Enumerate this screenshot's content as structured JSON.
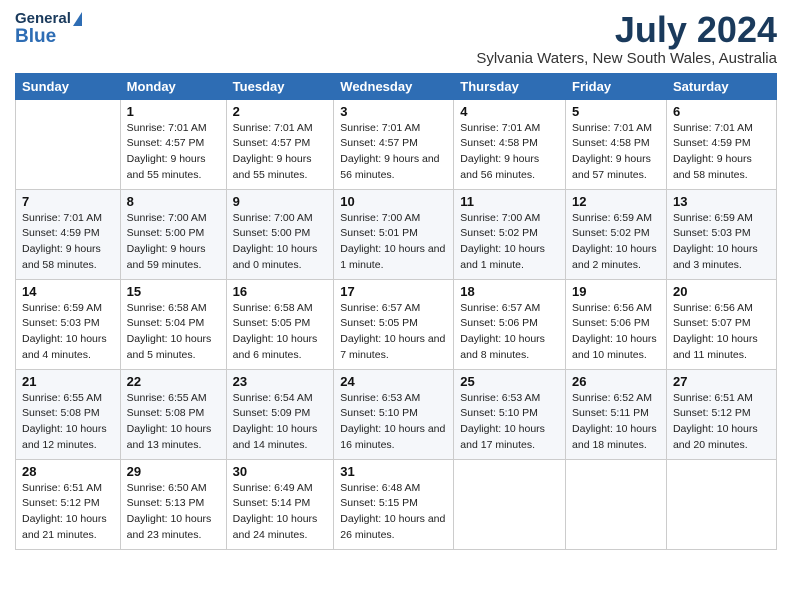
{
  "title": "July 2024",
  "subtitle": "Sylvania Waters, New South Wales, Australia",
  "logo": {
    "general": "General",
    "blue": "Blue"
  },
  "headers": [
    "Sunday",
    "Monday",
    "Tuesday",
    "Wednesday",
    "Thursday",
    "Friday",
    "Saturday"
  ],
  "weeks": [
    [
      {
        "day": "",
        "sunrise": "",
        "sunset": "",
        "daylight": ""
      },
      {
        "day": "1",
        "sunrise": "Sunrise: 7:01 AM",
        "sunset": "Sunset: 4:57 PM",
        "daylight": "Daylight: 9 hours and 55 minutes."
      },
      {
        "day": "2",
        "sunrise": "Sunrise: 7:01 AM",
        "sunset": "Sunset: 4:57 PM",
        "daylight": "Daylight: 9 hours and 55 minutes."
      },
      {
        "day": "3",
        "sunrise": "Sunrise: 7:01 AM",
        "sunset": "Sunset: 4:57 PM",
        "daylight": "Daylight: 9 hours and 56 minutes."
      },
      {
        "day": "4",
        "sunrise": "Sunrise: 7:01 AM",
        "sunset": "Sunset: 4:58 PM",
        "daylight": "Daylight: 9 hours and 56 minutes."
      },
      {
        "day": "5",
        "sunrise": "Sunrise: 7:01 AM",
        "sunset": "Sunset: 4:58 PM",
        "daylight": "Daylight: 9 hours and 57 minutes."
      },
      {
        "day": "6",
        "sunrise": "Sunrise: 7:01 AM",
        "sunset": "Sunset: 4:59 PM",
        "daylight": "Daylight: 9 hours and 58 minutes."
      }
    ],
    [
      {
        "day": "7",
        "sunrise": "Sunrise: 7:01 AM",
        "sunset": "Sunset: 4:59 PM",
        "daylight": "Daylight: 9 hours and 58 minutes."
      },
      {
        "day": "8",
        "sunrise": "Sunrise: 7:00 AM",
        "sunset": "Sunset: 5:00 PM",
        "daylight": "Daylight: 9 hours and 59 minutes."
      },
      {
        "day": "9",
        "sunrise": "Sunrise: 7:00 AM",
        "sunset": "Sunset: 5:00 PM",
        "daylight": "Daylight: 10 hours and 0 minutes."
      },
      {
        "day": "10",
        "sunrise": "Sunrise: 7:00 AM",
        "sunset": "Sunset: 5:01 PM",
        "daylight": "Daylight: 10 hours and 1 minute."
      },
      {
        "day": "11",
        "sunrise": "Sunrise: 7:00 AM",
        "sunset": "Sunset: 5:02 PM",
        "daylight": "Daylight: 10 hours and 1 minute."
      },
      {
        "day": "12",
        "sunrise": "Sunrise: 6:59 AM",
        "sunset": "Sunset: 5:02 PM",
        "daylight": "Daylight: 10 hours and 2 minutes."
      },
      {
        "day": "13",
        "sunrise": "Sunrise: 6:59 AM",
        "sunset": "Sunset: 5:03 PM",
        "daylight": "Daylight: 10 hours and 3 minutes."
      }
    ],
    [
      {
        "day": "14",
        "sunrise": "Sunrise: 6:59 AM",
        "sunset": "Sunset: 5:03 PM",
        "daylight": "Daylight: 10 hours and 4 minutes."
      },
      {
        "day": "15",
        "sunrise": "Sunrise: 6:58 AM",
        "sunset": "Sunset: 5:04 PM",
        "daylight": "Daylight: 10 hours and 5 minutes."
      },
      {
        "day": "16",
        "sunrise": "Sunrise: 6:58 AM",
        "sunset": "Sunset: 5:05 PM",
        "daylight": "Daylight: 10 hours and 6 minutes."
      },
      {
        "day": "17",
        "sunrise": "Sunrise: 6:57 AM",
        "sunset": "Sunset: 5:05 PM",
        "daylight": "Daylight: 10 hours and 7 minutes."
      },
      {
        "day": "18",
        "sunrise": "Sunrise: 6:57 AM",
        "sunset": "Sunset: 5:06 PM",
        "daylight": "Daylight: 10 hours and 8 minutes."
      },
      {
        "day": "19",
        "sunrise": "Sunrise: 6:56 AM",
        "sunset": "Sunset: 5:06 PM",
        "daylight": "Daylight: 10 hours and 10 minutes."
      },
      {
        "day": "20",
        "sunrise": "Sunrise: 6:56 AM",
        "sunset": "Sunset: 5:07 PM",
        "daylight": "Daylight: 10 hours and 11 minutes."
      }
    ],
    [
      {
        "day": "21",
        "sunrise": "Sunrise: 6:55 AM",
        "sunset": "Sunset: 5:08 PM",
        "daylight": "Daylight: 10 hours and 12 minutes."
      },
      {
        "day": "22",
        "sunrise": "Sunrise: 6:55 AM",
        "sunset": "Sunset: 5:08 PM",
        "daylight": "Daylight: 10 hours and 13 minutes."
      },
      {
        "day": "23",
        "sunrise": "Sunrise: 6:54 AM",
        "sunset": "Sunset: 5:09 PM",
        "daylight": "Daylight: 10 hours and 14 minutes."
      },
      {
        "day": "24",
        "sunrise": "Sunrise: 6:53 AM",
        "sunset": "Sunset: 5:10 PM",
        "daylight": "Daylight: 10 hours and 16 minutes."
      },
      {
        "day": "25",
        "sunrise": "Sunrise: 6:53 AM",
        "sunset": "Sunset: 5:10 PM",
        "daylight": "Daylight: 10 hours and 17 minutes."
      },
      {
        "day": "26",
        "sunrise": "Sunrise: 6:52 AM",
        "sunset": "Sunset: 5:11 PM",
        "daylight": "Daylight: 10 hours and 18 minutes."
      },
      {
        "day": "27",
        "sunrise": "Sunrise: 6:51 AM",
        "sunset": "Sunset: 5:12 PM",
        "daylight": "Daylight: 10 hours and 20 minutes."
      }
    ],
    [
      {
        "day": "28",
        "sunrise": "Sunrise: 6:51 AM",
        "sunset": "Sunset: 5:12 PM",
        "daylight": "Daylight: 10 hours and 21 minutes."
      },
      {
        "day": "29",
        "sunrise": "Sunrise: 6:50 AM",
        "sunset": "Sunset: 5:13 PM",
        "daylight": "Daylight: 10 hours and 23 minutes."
      },
      {
        "day": "30",
        "sunrise": "Sunrise: 6:49 AM",
        "sunset": "Sunset: 5:14 PM",
        "daylight": "Daylight: 10 hours and 24 minutes."
      },
      {
        "day": "31",
        "sunrise": "Sunrise: 6:48 AM",
        "sunset": "Sunset: 5:15 PM",
        "daylight": "Daylight: 10 hours and 26 minutes."
      },
      {
        "day": "",
        "sunrise": "",
        "sunset": "",
        "daylight": ""
      },
      {
        "day": "",
        "sunrise": "",
        "sunset": "",
        "daylight": ""
      },
      {
        "day": "",
        "sunrise": "",
        "sunset": "",
        "daylight": ""
      }
    ]
  ]
}
